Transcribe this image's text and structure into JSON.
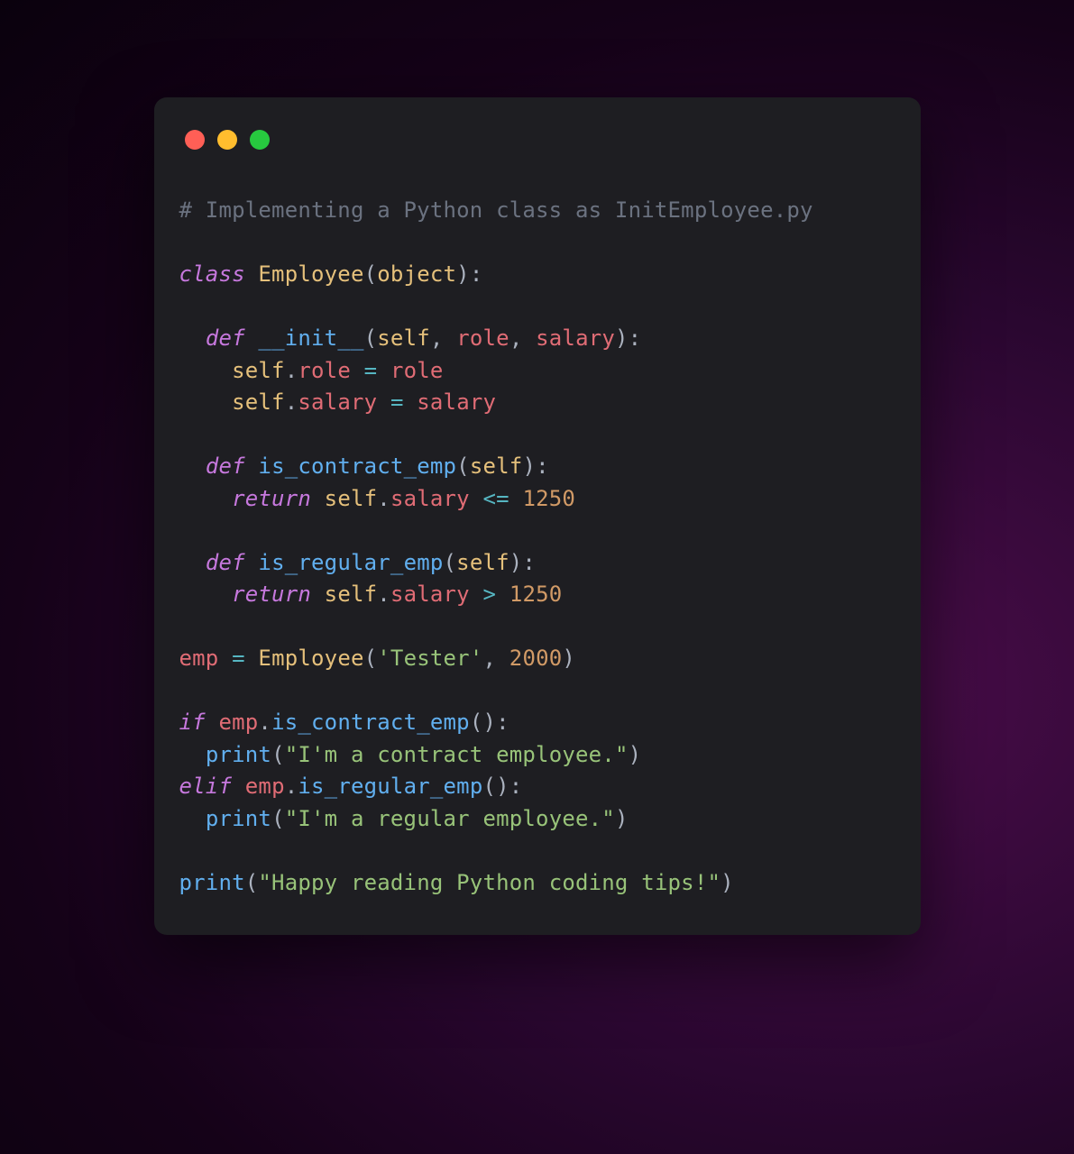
{
  "window": {
    "traffic_colors": {
      "close": "#ff5f56",
      "minimize": "#ffbd2e",
      "zoom": "#27c93f"
    }
  },
  "code": {
    "comment": "# Implementing a Python class as InitEmployee.py",
    "kw_class": "class",
    "cls_name": "Employee",
    "builtin_object": "object",
    "kw_def": "def",
    "fn_init": "__init__",
    "param_self": "self",
    "param_role": "role",
    "param_salary": "salary",
    "attr_role": "role",
    "attr_salary": "salary",
    "fn_is_contract": "is_contract_emp",
    "fn_is_regular": "is_regular_emp",
    "kw_return": "return",
    "op_le": "<=",
    "op_gt": ">",
    "num_1250": "1250",
    "ident_emp": "emp",
    "str_tester": "'Tester'",
    "num_2000": "2000",
    "kw_if": "if",
    "kw_elif": "elif",
    "fn_print": "print",
    "str_contract": "\"I'm a contract employee.\"",
    "str_regular": "\"I'm a regular employee.\"",
    "str_happy": "\"Happy reading Python coding tips!\""
  }
}
